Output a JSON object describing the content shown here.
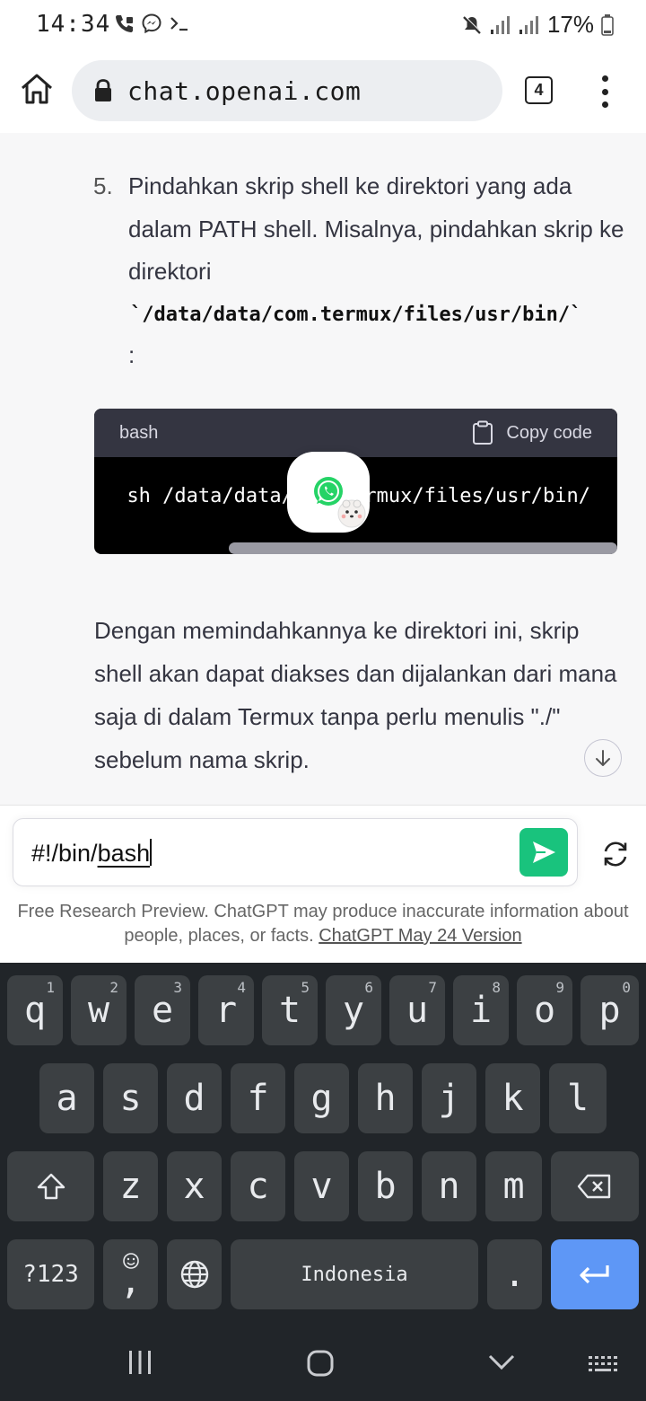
{
  "status_bar": {
    "time": "14:34",
    "battery": "17%"
  },
  "browser": {
    "url": "chat.openai.com",
    "tab_count": "4"
  },
  "chat": {
    "step_number": "5.",
    "step_text": "Pindahkan skrip shell ke direktori yang ada dalam PATH shell. Misalnya, pindahkan skrip ke direktori",
    "step_code": "`/data/data/com.termux/files/usr/bin/`",
    "step_colon": ":",
    "code_block": {
      "language": "bash",
      "copy_label": "Copy code",
      "code": "sh /data/data/com.termux/files/usr/bin/"
    },
    "paragraph": "Dengan memindahkannya ke direktori ini, skrip shell akan dapat diakses dan dijalankan dari mana saja di dalam Termux tanpa perlu menulis \"./\" sebelum nama skrip."
  },
  "composer": {
    "input_prefix": "#!/bin/",
    "input_underlined": "bash",
    "disclaimer_text": "Free Research Preview. ChatGPT may produce inaccurate information about people, places, or facts.",
    "disclaimer_link": "ChatGPT May 24 Version"
  },
  "keyboard": {
    "row1": [
      {
        "label": "q",
        "hint": "1"
      },
      {
        "label": "w",
        "hint": "2"
      },
      {
        "label": "e",
        "hint": "3"
      },
      {
        "label": "r",
        "hint": "4"
      },
      {
        "label": "t",
        "hint": "5"
      },
      {
        "label": "y",
        "hint": "6"
      },
      {
        "label": "u",
        "hint": "7"
      },
      {
        "label": "i",
        "hint": "8"
      },
      {
        "label": "o",
        "hint": "9"
      },
      {
        "label": "p",
        "hint": "0"
      }
    ],
    "row2": [
      "a",
      "s",
      "d",
      "f",
      "g",
      "h",
      "j",
      "k",
      "l"
    ],
    "row3": [
      "z",
      "x",
      "c",
      "v",
      "b",
      "n",
      "m"
    ],
    "symbols_label": "?123",
    "comma_label": ",",
    "space_label": "Indonesia",
    "period_label": "."
  },
  "colors": {
    "send_button": "#19c37d",
    "enter_key": "#5e97f6",
    "keyboard_bg": "#212529",
    "key_bg": "#3c4043",
    "chat_bg": "#f7f7f8",
    "code_header": "#343541"
  },
  "icons": {
    "home": "home-icon",
    "lock": "lock-icon",
    "menu": "more-vert-icon",
    "copy": "clipboard-icon",
    "scroll": "arrow-down-icon",
    "send": "send-icon",
    "regenerate": "refresh-icon",
    "whatsapp": "whatsapp-icon",
    "shift": "shift-icon",
    "backspace": "backspace-icon",
    "emoji": "emoji-icon",
    "globe": "globe-icon",
    "enter": "enter-icon"
  }
}
